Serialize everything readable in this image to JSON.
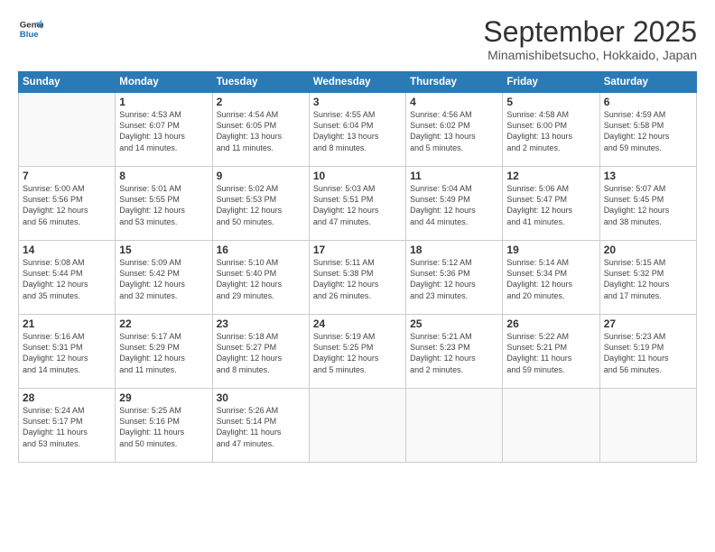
{
  "logo": {
    "line1": "General",
    "line2": "Blue"
  },
  "header": {
    "month": "September 2025",
    "location": "Minamishibetsucho, Hokkaido, Japan"
  },
  "weekdays": [
    "Sunday",
    "Monday",
    "Tuesday",
    "Wednesday",
    "Thursday",
    "Friday",
    "Saturday"
  ],
  "weeks": [
    [
      {
        "day": "",
        "info": ""
      },
      {
        "day": "1",
        "info": "Sunrise: 4:53 AM\nSunset: 6:07 PM\nDaylight: 13 hours\nand 14 minutes."
      },
      {
        "day": "2",
        "info": "Sunrise: 4:54 AM\nSunset: 6:05 PM\nDaylight: 13 hours\nand 11 minutes."
      },
      {
        "day": "3",
        "info": "Sunrise: 4:55 AM\nSunset: 6:04 PM\nDaylight: 13 hours\nand 8 minutes."
      },
      {
        "day": "4",
        "info": "Sunrise: 4:56 AM\nSunset: 6:02 PM\nDaylight: 13 hours\nand 5 minutes."
      },
      {
        "day": "5",
        "info": "Sunrise: 4:58 AM\nSunset: 6:00 PM\nDaylight: 13 hours\nand 2 minutes."
      },
      {
        "day": "6",
        "info": "Sunrise: 4:59 AM\nSunset: 5:58 PM\nDaylight: 12 hours\nand 59 minutes."
      }
    ],
    [
      {
        "day": "7",
        "info": "Sunrise: 5:00 AM\nSunset: 5:56 PM\nDaylight: 12 hours\nand 56 minutes."
      },
      {
        "day": "8",
        "info": "Sunrise: 5:01 AM\nSunset: 5:55 PM\nDaylight: 12 hours\nand 53 minutes."
      },
      {
        "day": "9",
        "info": "Sunrise: 5:02 AM\nSunset: 5:53 PM\nDaylight: 12 hours\nand 50 minutes."
      },
      {
        "day": "10",
        "info": "Sunrise: 5:03 AM\nSunset: 5:51 PM\nDaylight: 12 hours\nand 47 minutes."
      },
      {
        "day": "11",
        "info": "Sunrise: 5:04 AM\nSunset: 5:49 PM\nDaylight: 12 hours\nand 44 minutes."
      },
      {
        "day": "12",
        "info": "Sunrise: 5:06 AM\nSunset: 5:47 PM\nDaylight: 12 hours\nand 41 minutes."
      },
      {
        "day": "13",
        "info": "Sunrise: 5:07 AM\nSunset: 5:45 PM\nDaylight: 12 hours\nand 38 minutes."
      }
    ],
    [
      {
        "day": "14",
        "info": "Sunrise: 5:08 AM\nSunset: 5:44 PM\nDaylight: 12 hours\nand 35 minutes."
      },
      {
        "day": "15",
        "info": "Sunrise: 5:09 AM\nSunset: 5:42 PM\nDaylight: 12 hours\nand 32 minutes."
      },
      {
        "day": "16",
        "info": "Sunrise: 5:10 AM\nSunset: 5:40 PM\nDaylight: 12 hours\nand 29 minutes."
      },
      {
        "day": "17",
        "info": "Sunrise: 5:11 AM\nSunset: 5:38 PM\nDaylight: 12 hours\nand 26 minutes."
      },
      {
        "day": "18",
        "info": "Sunrise: 5:12 AM\nSunset: 5:36 PM\nDaylight: 12 hours\nand 23 minutes."
      },
      {
        "day": "19",
        "info": "Sunrise: 5:14 AM\nSunset: 5:34 PM\nDaylight: 12 hours\nand 20 minutes."
      },
      {
        "day": "20",
        "info": "Sunrise: 5:15 AM\nSunset: 5:32 PM\nDaylight: 12 hours\nand 17 minutes."
      }
    ],
    [
      {
        "day": "21",
        "info": "Sunrise: 5:16 AM\nSunset: 5:31 PM\nDaylight: 12 hours\nand 14 minutes."
      },
      {
        "day": "22",
        "info": "Sunrise: 5:17 AM\nSunset: 5:29 PM\nDaylight: 12 hours\nand 11 minutes."
      },
      {
        "day": "23",
        "info": "Sunrise: 5:18 AM\nSunset: 5:27 PM\nDaylight: 12 hours\nand 8 minutes."
      },
      {
        "day": "24",
        "info": "Sunrise: 5:19 AM\nSunset: 5:25 PM\nDaylight: 12 hours\nand 5 minutes."
      },
      {
        "day": "25",
        "info": "Sunrise: 5:21 AM\nSunset: 5:23 PM\nDaylight: 12 hours\nand 2 minutes."
      },
      {
        "day": "26",
        "info": "Sunrise: 5:22 AM\nSunset: 5:21 PM\nDaylight: 11 hours\nand 59 minutes."
      },
      {
        "day": "27",
        "info": "Sunrise: 5:23 AM\nSunset: 5:19 PM\nDaylight: 11 hours\nand 56 minutes."
      }
    ],
    [
      {
        "day": "28",
        "info": "Sunrise: 5:24 AM\nSunset: 5:17 PM\nDaylight: 11 hours\nand 53 minutes."
      },
      {
        "day": "29",
        "info": "Sunrise: 5:25 AM\nSunset: 5:16 PM\nDaylight: 11 hours\nand 50 minutes."
      },
      {
        "day": "30",
        "info": "Sunrise: 5:26 AM\nSunset: 5:14 PM\nDaylight: 11 hours\nand 47 minutes."
      },
      {
        "day": "",
        "info": ""
      },
      {
        "day": "",
        "info": ""
      },
      {
        "day": "",
        "info": ""
      },
      {
        "day": "",
        "info": ""
      }
    ]
  ]
}
